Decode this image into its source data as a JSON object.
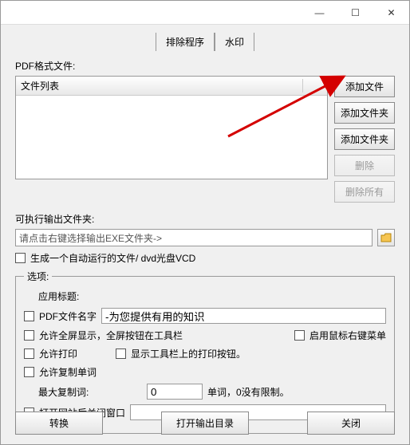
{
  "titlebar": {
    "minimize": "—",
    "maximize": "☐",
    "close": "✕"
  },
  "tabs": {
    "exclude": "排除程序",
    "watermark": "水印"
  },
  "labels": {
    "pdf_files": "PDF格式文件:",
    "file_list_header": "文件列表",
    "output_folder": "可执行输出文件夹:",
    "output_placeholder": "请点击右键选择输出EXE文件夹->",
    "autorun": "生成一个自动运行的文件/ dvd光盘VCD",
    "options_legend": "选项:",
    "app_title": "应用标题:",
    "pdf_name": "PDF文件名字",
    "pdf_name_value": "-为您提供有用的知识",
    "fullscreen": "允许全屏显示，全屏按钮在工具栏",
    "enable_rightclick": "启用鼠标右键菜单",
    "allow_print": "允许打印",
    "show_print_btn": "显示工具栏上的打印按钮。",
    "allow_copy": "允许复制单词",
    "max_copy": "最大复制词:",
    "max_copy_value": "0",
    "max_copy_unit": "单词，0没有限制。",
    "close_after_open": "打开网站后关闭窗口"
  },
  "buttons": {
    "add_file": "添加文件",
    "add_folder1": "添加文件夹",
    "add_folder2": "添加文件夹",
    "delete": "删除",
    "delete_all": "删除所有",
    "convert": "转换",
    "open_output": "打开输出目录",
    "close": "关闭"
  }
}
